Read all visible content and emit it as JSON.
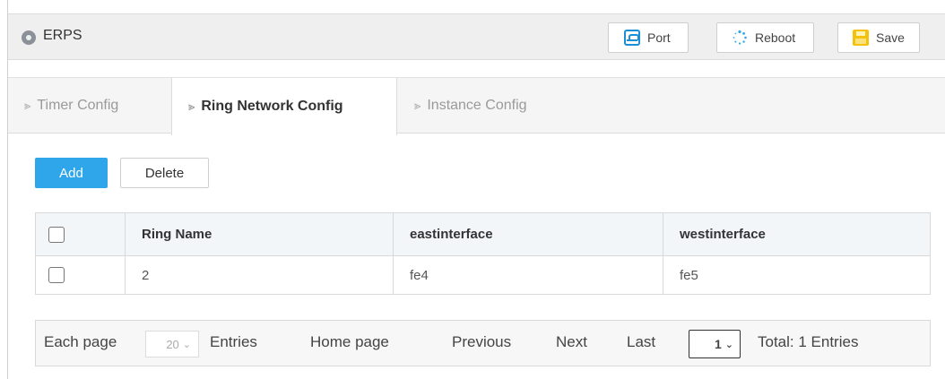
{
  "header": {
    "title": "ERPS",
    "buttons": {
      "port": "Port",
      "reboot": "Reboot",
      "save": "Save"
    }
  },
  "tabs": [
    {
      "label": "Timer Config",
      "active": false
    },
    {
      "label": "Ring Network Config",
      "active": true
    },
    {
      "label": "Instance Config",
      "active": false
    }
  ],
  "actions": {
    "add": "Add",
    "delete": "Delete"
  },
  "table": {
    "columns": [
      "Ring Name",
      "eastinterface",
      "westinterface"
    ],
    "rows": [
      {
        "ring_name": "2",
        "east": "fe4",
        "west": "fe5"
      }
    ]
  },
  "pagination": {
    "each_page": "Each page",
    "page_size": "20",
    "entries": "Entries",
    "home": "Home page",
    "previous": "Previous",
    "next": "Next",
    "last": "Last",
    "current_page": "1",
    "total": "Total: 1 Entries"
  },
  "colors": {
    "accent": "#2fa6e9",
    "port_icon": "#1a8fd8",
    "save_icon": "#f4c20d",
    "reboot_icon": "#2fa6e9"
  },
  "icons": {
    "title": "location-pin-icon",
    "port": "port-icon",
    "reboot": "reboot-spinner-icon",
    "save": "save-icon",
    "tab_arrow": "chevron-right-icon"
  }
}
